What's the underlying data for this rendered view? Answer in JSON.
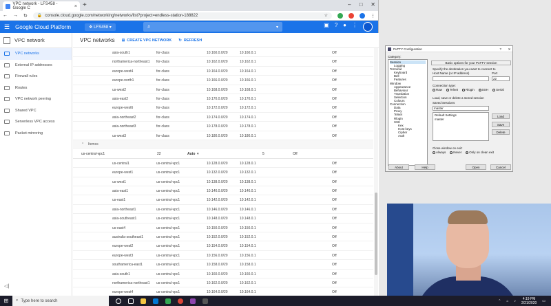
{
  "browser": {
    "tab_title": "VPC network - LFS458 - Google C",
    "tab_close": "×",
    "new_tab": "+",
    "url": "console.cloud.google.com/networking/networks/list?project=endless-station-188822"
  },
  "gcp": {
    "title": "Google Cloud Platform",
    "project": "LFS458"
  },
  "sidebar": {
    "header": "VPC network",
    "items": [
      {
        "label": "VPC networks",
        "active": true
      },
      {
        "label": "External IP addresses",
        "active": false
      },
      {
        "label": "Firewall rules",
        "active": false
      },
      {
        "label": "Routes",
        "active": false
      },
      {
        "label": "VPC network peering",
        "active": false
      },
      {
        "label": "Shared VPC",
        "active": false
      },
      {
        "label": "Serverless VPC access",
        "active": false
      },
      {
        "label": "Packet mirroring",
        "active": false
      }
    ],
    "collapse": "◁|"
  },
  "main": {
    "title": "VPC networks",
    "create_label": "CREATE VPC NETWORK",
    "refresh_label": "REFRESH",
    "top_rows": [
      [
        "asia-south1",
        "for-class",
        "10.160.0.0/20",
        "10.160.0.1",
        "Off"
      ],
      [
        "northamerica-northeast1",
        "for-class",
        "10.162.0.0/20",
        "10.162.0.1",
        "Off"
      ],
      [
        "europe-west4",
        "for-class",
        "10.164.0.0/20",
        "10.164.0.1",
        "Off"
      ],
      [
        "europe-north1",
        "for-class",
        "10.166.0.0/20",
        "10.166.0.1",
        "Off"
      ],
      [
        "us-west2",
        "for-class",
        "10.168.0.0/20",
        "10.168.0.1",
        "Off"
      ],
      [
        "asia-east2",
        "for-class",
        "10.170.0.0/20",
        "10.170.0.1",
        "Off"
      ],
      [
        "europe-west6",
        "for-class",
        "10.172.0.0/20",
        "10.172.0.1",
        "Off"
      ],
      [
        "asia-northeast2",
        "for-class",
        "10.174.0.0/20",
        "10.174.0.1",
        "Off"
      ],
      [
        "asia-northeast3",
        "for-class",
        "10.178.0.0/20",
        "10.178.0.1",
        "Off"
      ],
      [
        "us-west3",
        "for-class",
        "10.180.0.0/20",
        "10.180.0.1",
        "Off"
      ]
    ],
    "net_row": {
      "label": "Itemss"
    },
    "vpc_row": {
      "name": "us-central-vpc1",
      "subnets": "22",
      "mode": "Auto",
      "routes": "5",
      "flow": "Off"
    },
    "bottom_rows": [
      [
        "us-central1",
        "us-central-vpc1",
        "10.128.0.0/20",
        "10.128.0.1",
        "Off"
      ],
      [
        "europe-west1",
        "us-central-vpc1",
        "10.132.0.0/20",
        "10.132.0.1",
        "Off"
      ],
      [
        "us-west1",
        "us-central-vpc1",
        "10.138.0.0/20",
        "10.138.0.1",
        "Off"
      ],
      [
        "asia-east1",
        "us-central-vpc1",
        "10.140.0.0/20",
        "10.140.0.1",
        "Off"
      ],
      [
        "us-east1",
        "us-central-vpc1",
        "10.142.0.0/20",
        "10.142.0.1",
        "Off"
      ],
      [
        "asia-northeast1",
        "us-central-vpc1",
        "10.146.0.0/20",
        "10.146.0.1",
        "Off"
      ],
      [
        "asia-southeast1",
        "us-central-vpc1",
        "10.148.0.0/20",
        "10.148.0.1",
        "Off"
      ],
      [
        "us-east4",
        "us-central-vpc1",
        "10.150.0.0/20",
        "10.150.0.1",
        "Off"
      ],
      [
        "australia-southeast1",
        "us-central-vpc1",
        "10.152.0.0/20",
        "10.152.0.1",
        "Off"
      ],
      [
        "europe-west2",
        "us-central-vpc1",
        "10.154.0.0/20",
        "10.154.0.1",
        "Off"
      ],
      [
        "europe-west3",
        "us-central-vpc1",
        "10.156.0.0/20",
        "10.156.0.1",
        "Off"
      ],
      [
        "southamerica-east1",
        "us-central-vpc1",
        "10.158.0.0/20",
        "10.158.0.1",
        "Off"
      ],
      [
        "asia-south1",
        "us-central-vpc1",
        "10.160.0.0/20",
        "10.160.0.1",
        "Off"
      ],
      [
        "northamerica-northeast1",
        "us-central-vpc1",
        "10.162.0.0/20",
        "10.162.0.1",
        "Off"
      ],
      [
        "europe-west4",
        "us-central-vpc1",
        "10.164.0.0/20",
        "10.164.0.1",
        "Off"
      ]
    ]
  },
  "putty": {
    "title": "PuTTY Configuration",
    "ctl_help": "?",
    "ctl_close": "X",
    "category_label": "Category:",
    "tree": [
      {
        "label": "Session",
        "level": 0
      },
      {
        "label": "Logging",
        "level": 1
      },
      {
        "label": "Terminal",
        "level": 0
      },
      {
        "label": "Keyboard",
        "level": 1
      },
      {
        "label": "Bell",
        "level": 1
      },
      {
        "label": "Features",
        "level": 1
      },
      {
        "label": "Window",
        "level": 0
      },
      {
        "label": "Appearance",
        "level": 1
      },
      {
        "label": "Behaviour",
        "level": 1
      },
      {
        "label": "Translation",
        "level": 1
      },
      {
        "label": "Selection",
        "level": 1
      },
      {
        "label": "Colours",
        "level": 1
      },
      {
        "label": "Connection",
        "level": 0
      },
      {
        "label": "Data",
        "level": 1
      },
      {
        "label": "Proxy",
        "level": 1
      },
      {
        "label": "Telnet",
        "level": 1
      },
      {
        "label": "Rlogin",
        "level": 1
      },
      {
        "label": "SSH",
        "level": 1
      },
      {
        "label": "Kex",
        "level": 2
      },
      {
        "label": "Host keys",
        "level": 2
      },
      {
        "label": "Cipher",
        "level": 2
      },
      {
        "label": "Auth",
        "level": 2
      }
    ],
    "basic_options": "Basic options for your PuTTY session",
    "specify_dest": "Specify the destination you want to connect to",
    "host_label": "Host Name (or IP address)",
    "port_label": "Port",
    "port_value": "22",
    "conn_type_label": "Connection type:",
    "conn_types": [
      "Raw",
      "Telnet",
      "Rlogin",
      "SSH",
      "Serial"
    ],
    "conn_selected": "SSH",
    "load_save_label": "Load, save or delete a stored session",
    "saved_sessions_label": "Saved Sessions",
    "saved_session_value": "master",
    "sessions_list": [
      "Default Settings",
      "master"
    ],
    "load_btn": "Load",
    "save_btn": "Save",
    "delete_btn": "Delete",
    "close_window_label": "Close window on exit:",
    "close_options": [
      "Always",
      "Never",
      "Only on clean exit"
    ],
    "close_selected": "Only on clean exit",
    "about_btn": "About",
    "help_btn": "Help",
    "open_btn": "Open",
    "cancel_btn": "Cancel"
  },
  "taskbar": {
    "search_placeholder": "Type here to search",
    "time": "4:19 PM",
    "date": "2/21/2020"
  }
}
